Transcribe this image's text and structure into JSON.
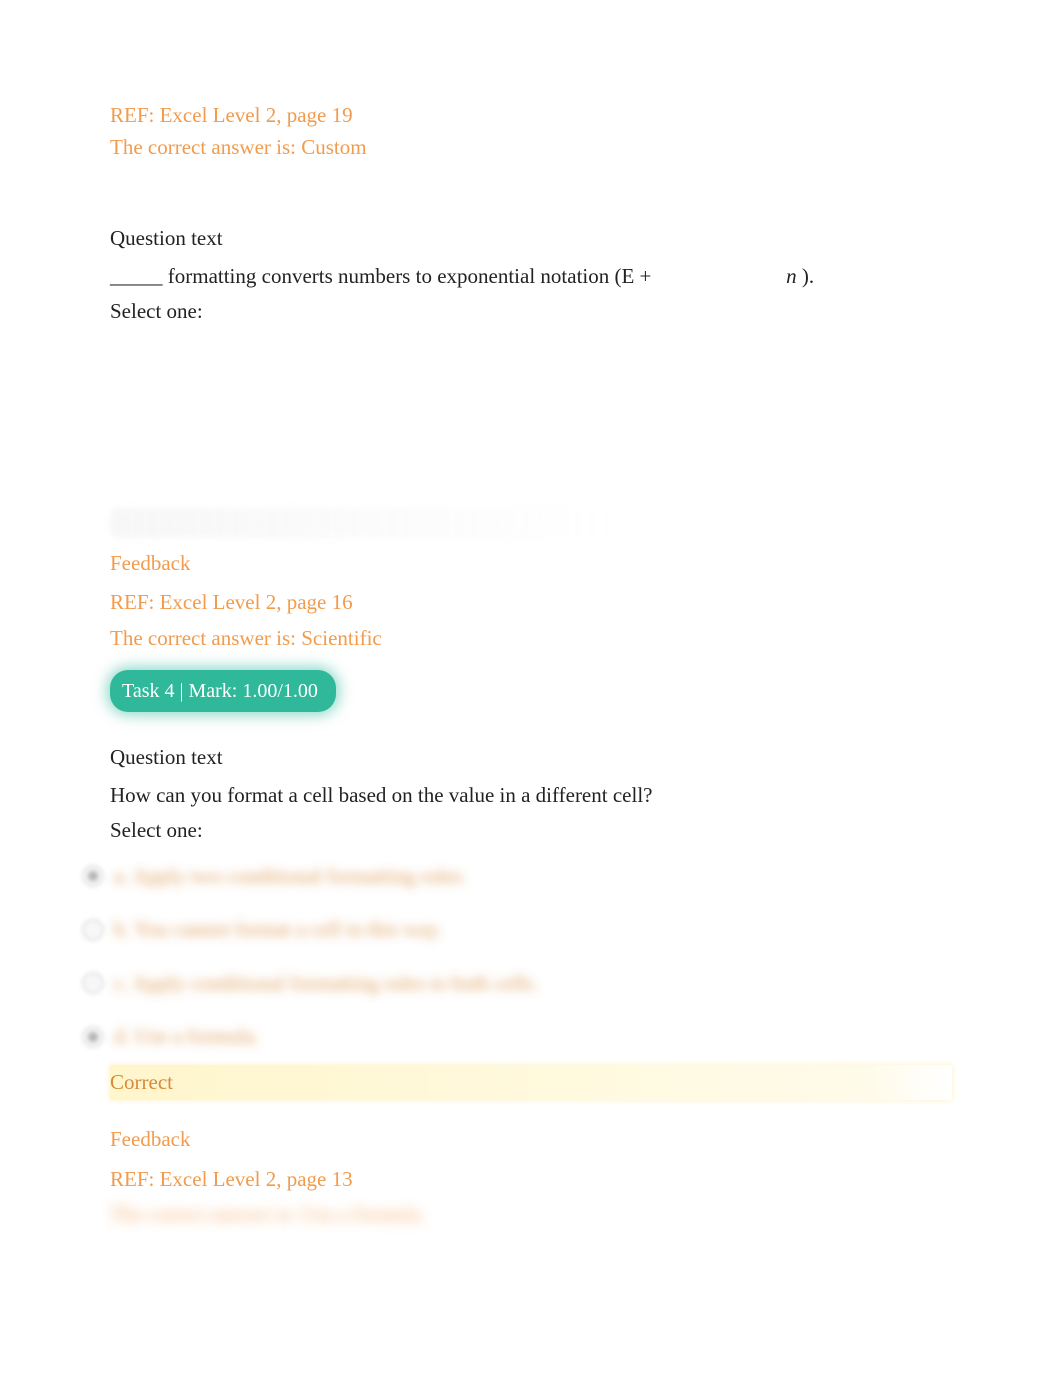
{
  "q_prev": {
    "ref": "REF: Excel Level 2, page 19",
    "answer": "The correct answer is: Custom"
  },
  "q3": {
    "header": "Question text",
    "prompt_before": "_____ formatting converts numbers to exponential notation (E + ",
    "prompt_n": "n",
    "prompt_after": ").",
    "select": "Select one:",
    "feedback_label": "Feedback",
    "ref": "REF: Excel Level 2, page 16",
    "answer": "The correct answer is: Scientific"
  },
  "task_pill": "Task 4 | Mark: 1.00/1.00",
  "q4": {
    "header": "Question text",
    "prompt": "How can you format a cell based on the value in a different cell?",
    "select": "Select one:",
    "options": {
      "a": "a. Apply two conditional formatting rules.",
      "b": "b. You cannot format a cell in this way.",
      "c": "c. Apply conditional formatting rules to both cells.",
      "d": "d. Use a formula."
    },
    "correct_banner": "Correct",
    "feedback_label": "Feedback",
    "ref": "REF: Excel Level 2, page 13",
    "answer": "The correct answer is: Use a formula."
  }
}
